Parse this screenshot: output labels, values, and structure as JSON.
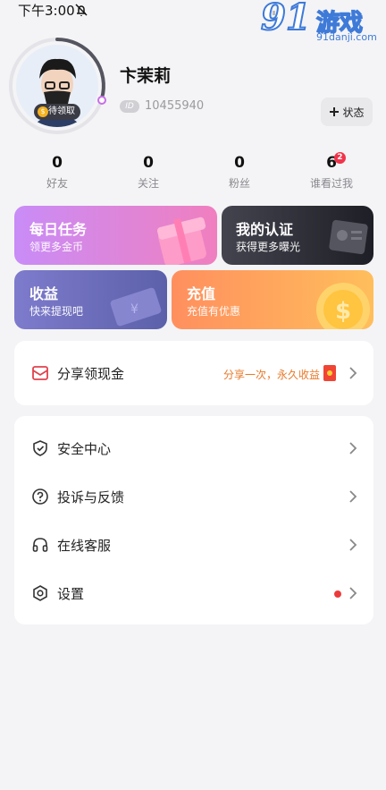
{
  "status_bar": {
    "time": "下午3:00"
  },
  "watermark": {
    "big": "91",
    "cn": "游戏",
    "url": "91danji.com"
  },
  "profile": {
    "username": "卞茉莉",
    "uid_tag": "ID",
    "uid": "10455940",
    "pending_label": "待领取",
    "pending_coin": "$",
    "status_button": "状态"
  },
  "stats": [
    {
      "value": "0",
      "label": "好友"
    },
    {
      "value": "0",
      "label": "关注"
    },
    {
      "value": "0",
      "label": "粉丝"
    },
    {
      "value": "6",
      "label": "谁看过我",
      "badge": "2"
    }
  ],
  "cards": {
    "daily": {
      "title": "每日任务",
      "sub": "领更多金币"
    },
    "verify": {
      "title": "我的认证",
      "sub": "获得更多曝光"
    },
    "income": {
      "title": "收益",
      "sub": "快来提现吧"
    },
    "recharge": {
      "title": "充值",
      "sub": "充值有优惠"
    }
  },
  "share": {
    "label": "分享领现金",
    "promo": "分享一次，永久收益"
  },
  "menu": [
    {
      "label": "安全中心",
      "icon": "shield-icon"
    },
    {
      "label": "投诉与反馈",
      "icon": "question-icon"
    },
    {
      "label": "在线客服",
      "icon": "headset-icon"
    },
    {
      "label": "设置",
      "icon": "settings-icon",
      "dot": true
    }
  ],
  "colors": {
    "daily_gradient": [
      "#c98cf7",
      "#f27fc1"
    ],
    "verify_gradient": [
      "#3a3a45",
      "#1d1d24"
    ],
    "income_gradient": [
      "#7a78c8",
      "#5b5fa8"
    ],
    "recharge_gradient": [
      "#ff9a5f",
      "#ffbd5a"
    ],
    "accent_red": "#ec3a3a",
    "promo_orange": "#e8792a"
  }
}
